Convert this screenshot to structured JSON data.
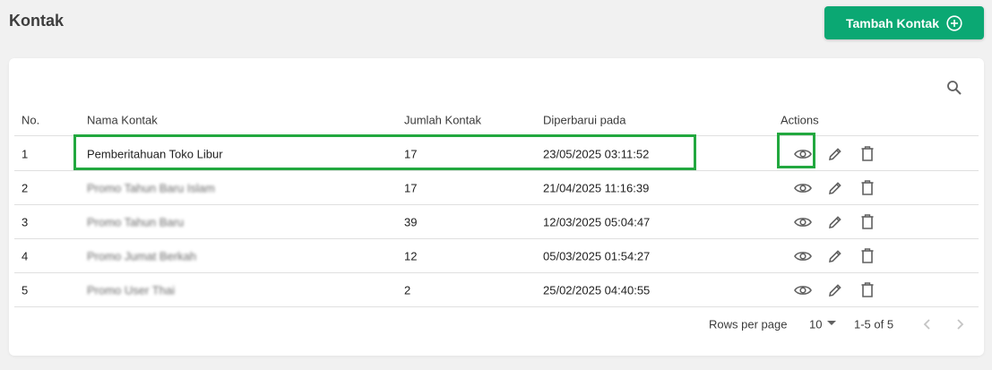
{
  "header": {
    "title": "Kontak",
    "add_button_label": "Tambah Kontak",
    "add_button_icon": "plus-circle-icon",
    "accent_color": "#0ba873"
  },
  "table": {
    "search_icon": "search-icon",
    "columns": {
      "no": "No.",
      "name": "Nama Kontak",
      "count": "Jumlah Kontak",
      "updated": "Diperbarui pada",
      "actions": "Actions"
    },
    "rows": [
      {
        "no": "1",
        "name": "Pemberitahuan Toko Libur",
        "count": "17",
        "updated": "23/05/2025 03:11:52"
      },
      {
        "no": "2",
        "name": "Promo Tahun Baru Islam",
        "count": "17",
        "updated": "21/04/2025 11:16:39"
      },
      {
        "no": "3",
        "name": "Promo Tahun Baru",
        "count": "39",
        "updated": "12/03/2025 05:04:47"
      },
      {
        "no": "4",
        "name": "Promo Jumat Berkah",
        "count": "12",
        "updated": "05/03/2025 01:54:27"
      },
      {
        "no": "5",
        "name": "Promo User Thai",
        "count": "2",
        "updated": "25/02/2025 04:40:55"
      }
    ],
    "row_action_icons": [
      "eye-icon",
      "pencil-icon",
      "trash-icon"
    ]
  },
  "pagination": {
    "rows_per_page_label": "Rows per page",
    "rows_per_page_value": "10",
    "range_label": "1-5 of 5"
  },
  "highlight_color": "#22a83f"
}
